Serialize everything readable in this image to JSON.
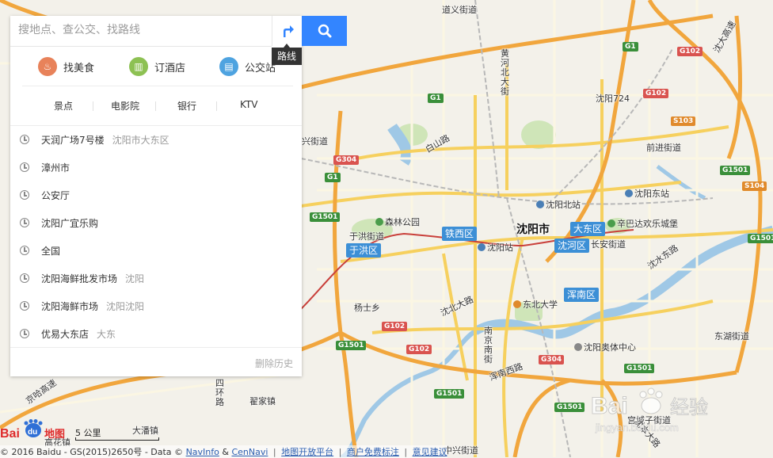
{
  "search": {
    "placeholder": "搜地点、查公交、找路线",
    "route_tooltip": "路线"
  },
  "quick_links": [
    {
      "label": "找美食",
      "color": "#e8825a"
    },
    {
      "label": "订酒店",
      "color": "#8dc153"
    },
    {
      "label": "公交站",
      "color": "#4ea3e0"
    }
  ],
  "categories": [
    "景点",
    "电影院",
    "银行",
    "KTV"
  ],
  "history": [
    {
      "name": "天润广场7号楼",
      "addr": "沈阳市大东区"
    },
    {
      "name": "漳州市",
      "addr": ""
    },
    {
      "name": "公安厅",
      "addr": ""
    },
    {
      "name": "沈阳广宜乐购",
      "addr": ""
    },
    {
      "name": "全国",
      "addr": ""
    },
    {
      "name": "沈阳海鲜批发市场",
      "addr": "沈阳"
    },
    {
      "name": "沈阳海鲜市场",
      "addr": "沈阳沈阳"
    },
    {
      "name": "优易大东店",
      "addr": "大东"
    }
  ],
  "clear_history": "删除历史",
  "map": {
    "city": "沈阳市",
    "districts": [
      "铁西区",
      "大东区",
      "于洪区",
      "沈河区",
      "浑南区"
    ],
    "places": [
      "道义街道",
      "沈阳724",
      "前进街道",
      "沈阳北站",
      "沈阳东站",
      "辛巴达欢乐城堡",
      "长安街道",
      "森林公园",
      "于洪街道",
      "沈阳站",
      "杨士乡",
      "东北大学",
      "沈阳奥体中心",
      "东湖街道",
      "翟家镇",
      "宫城子街道",
      "大潘镇",
      "高花镇",
      "中兴街道",
      "兴街道"
    ],
    "roads": [
      "黄河北大街",
      "白山路",
      "沈大高速",
      "沈北大路",
      "沈水东路",
      "浑南西路",
      "南京南街",
      "四环路",
      "京哈高速",
      "沈本大路"
    ],
    "shields": [
      "G1",
      "G1",
      "G1",
      "G102",
      "G102",
      "S103",
      "G1501",
      "S104",
      "G1501",
      "G304",
      "G1501",
      "G102",
      "G1501",
      "G102",
      "G304",
      "G1501",
      "G1501",
      "G1501"
    ]
  },
  "footer": {
    "logo_text": "Bai 图",
    "logo_du": "du",
    "scale": "5 公里",
    "copyright_prefix": "© 2016 Baidu - GS(2015)2650号 - Data ©",
    "navinfo": "NavInfo",
    "amp": "&",
    "cennavi": "CenNavi",
    "link1": "地图开放平台",
    "link2": "商户免费标注",
    "link3": "意见建议"
  },
  "watermark": {
    "text": "Bai 经验",
    "url": "jingyan.baidu.com"
  },
  "colors": {
    "search_button": "#3385ff",
    "district_label": "#3c8fd6",
    "highway": "#f5b642",
    "river": "#9bc9e8",
    "park": "#c8e2b0"
  }
}
